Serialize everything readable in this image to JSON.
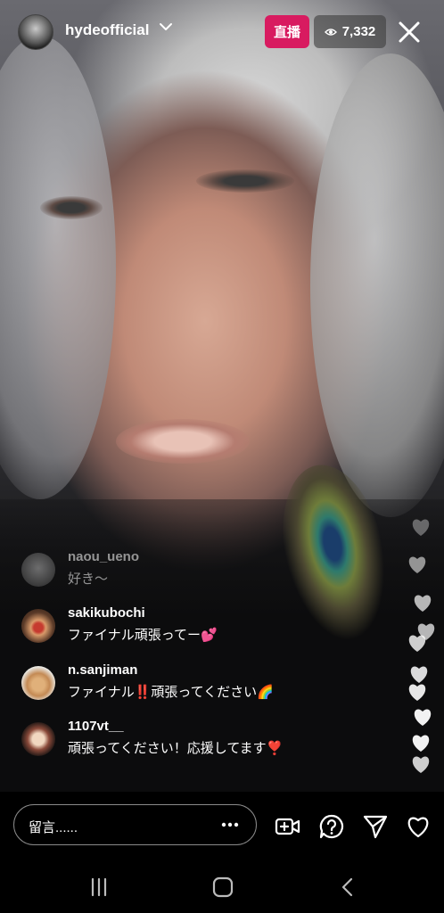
{
  "header": {
    "host_name": "hydeofficial",
    "live_label": "直播",
    "viewer_count": "7,332"
  },
  "comments": [
    {
      "username": "naou_ueno",
      "text": "好き〜",
      "faded": true
    },
    {
      "username": "sakikubochi",
      "text": "ファイナル頑張ってー💕",
      "faded": false
    },
    {
      "username": "n.sanjiman",
      "text": "ファイナル‼️頑張ってください🌈",
      "faded": false
    },
    {
      "username": "1107vt__",
      "text": "頑張ってください！応援してます❣️",
      "faded": false
    }
  ],
  "composer": {
    "placeholder": "留言......"
  },
  "colors": {
    "live_badge": "#d81b60",
    "viewer_badge_bg": "#3c3c3c"
  },
  "icons": {
    "add_guest": "add-video-icon",
    "question": "question-icon",
    "share": "send-icon",
    "like": "heart-icon"
  }
}
